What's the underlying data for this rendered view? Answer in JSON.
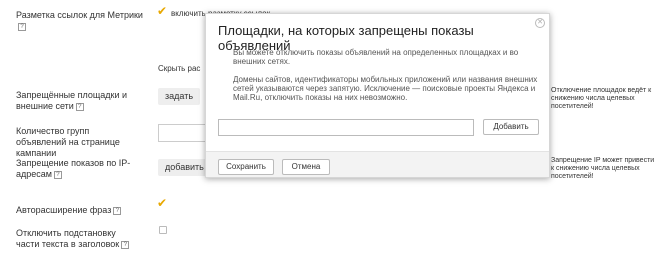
{
  "rows": [
    {
      "label": "Разметка ссылок для Метрики"
    },
    {
      "label": "Запрещённые площадки и внешние сети"
    },
    {
      "label": "Количество групп объявлений на странице кампании"
    },
    {
      "label": "Запрещение показов по IP-адресам"
    },
    {
      "label": "Авторасширение фраз"
    },
    {
      "label": "Отключить подстановку части текста в заголовок"
    }
  ],
  "metrika_checkbox_label": "включить разметку ссылок",
  "hide_text": "Скрыть рас",
  "set_button": "задать",
  "add_button_bg": "добавить",
  "notes": {
    "platforms": "Отключение площадок ведёт к снижению числа целевых посетителей!",
    "ip": "Запрещение IP может привести к снижению числа целевых посетителей!"
  },
  "modal": {
    "title": "Площадки, на которых запрещены показы объявлений",
    "p1": "Вы можете отключить показы объявлений на определенных площадках и во внешних сетях.",
    "p2": "Домены сайтов, идентификаторы мобильных приложений или названия внешних сетей указываются через запятую. Исключение — поисковые проекты Яндекса и Mail.Ru, отключить показы на них невозможно.",
    "input_value": "",
    "add_button": "Добавить",
    "save_button": "Сохранить",
    "cancel_button": "Отмена",
    "close_icon": "close-icon"
  },
  "colors": {
    "checkmark": "#e8a800"
  }
}
